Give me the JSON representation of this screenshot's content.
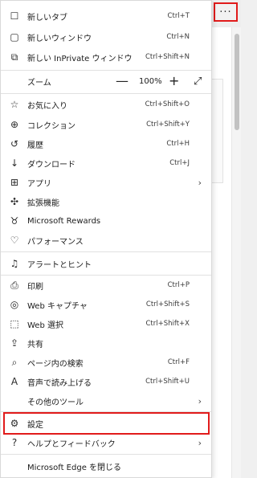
{
  "more_button": {
    "label": "···"
  },
  "menu": {
    "group1": [
      {
        "name": "new-tab",
        "icon": "new-tab-icon",
        "glyph": "☐",
        "label": "新しいタブ",
        "shortcut": "Ctrl+T"
      },
      {
        "name": "new-window",
        "icon": "new-window-icon",
        "glyph": "▢",
        "label": "新しいウィンドウ",
        "shortcut": "Ctrl+N"
      },
      {
        "name": "new-inprivate",
        "icon": "inprivate-icon",
        "glyph": "⧉",
        "label": "新しい InPrivate ウィンドウ",
        "shortcut": "Ctrl+Shift+N"
      }
    ],
    "zoom": {
      "label": "ズーム",
      "minus": "—",
      "value": "100%",
      "plus": "+",
      "expand": "⤢"
    },
    "group2": [
      {
        "name": "favorites",
        "icon": "favorites-icon",
        "glyph": "☆",
        "label": "お気に入り",
        "shortcut": "Ctrl+Shift+O"
      },
      {
        "name": "collections",
        "icon": "collections-icon",
        "glyph": "⊕",
        "label": "コレクション",
        "shortcut": "Ctrl+Shift+Y"
      },
      {
        "name": "history",
        "icon": "history-icon",
        "glyph": "↺",
        "label": "履歴",
        "shortcut": "Ctrl+H"
      },
      {
        "name": "downloads",
        "icon": "download-icon",
        "glyph": "↓",
        "label": "ダウンロード",
        "shortcut": "Ctrl+J"
      },
      {
        "name": "apps",
        "icon": "apps-icon",
        "glyph": "⊞",
        "label": "アプリ",
        "shortcut": "",
        "chevron": "›"
      },
      {
        "name": "extensions",
        "icon": "extensions-icon",
        "glyph": "✣",
        "label": "拡張機能",
        "shortcut": ""
      },
      {
        "name": "microsoft-rewards",
        "icon": "rewards-icon",
        "glyph": "♉",
        "label": "Microsoft Rewards",
        "shortcut": ""
      },
      {
        "name": "performance",
        "icon": "performance-icon",
        "glyph": "♡",
        "label": "パフォーマンス",
        "shortcut": ""
      }
    ],
    "group3": [
      {
        "name": "alerts-tips",
        "icon": "bell-icon",
        "glyph": "♫",
        "label": "アラートとヒント",
        "shortcut": ""
      }
    ],
    "group4": [
      {
        "name": "print",
        "icon": "printer-icon",
        "glyph": "⎙",
        "label": "印刷",
        "shortcut": "Ctrl+P"
      },
      {
        "name": "web-capture",
        "icon": "web-capture-icon",
        "glyph": "◎",
        "label": "Web キャプチャ",
        "shortcut": "Ctrl+Shift+S"
      },
      {
        "name": "web-select",
        "icon": "web-select-icon",
        "glyph": "⬚",
        "label": "Web 選択",
        "shortcut": "Ctrl+Shift+X"
      },
      {
        "name": "share",
        "icon": "share-icon",
        "glyph": "⇪",
        "label": "共有",
        "shortcut": ""
      },
      {
        "name": "find-on-page",
        "icon": "find-icon",
        "glyph": "⌕",
        "label": "ページ内の検索",
        "shortcut": "Ctrl+F"
      },
      {
        "name": "read-aloud",
        "icon": "read-aloud-icon",
        "glyph": "A",
        "label": "音声で読み上げる",
        "shortcut": "Ctrl+Shift+U"
      },
      {
        "name": "more-tools",
        "icon": "more-tools-icon",
        "glyph": "",
        "label": "その他のツール",
        "shortcut": "",
        "chevron": "›"
      }
    ],
    "group5": [
      {
        "name": "settings",
        "icon": "gear-icon",
        "glyph": "⚙",
        "label": "設定",
        "shortcut": ""
      },
      {
        "name": "help-feedback",
        "icon": "help-icon",
        "glyph": "?",
        "label": "ヘルプとフィードバック",
        "shortcut": "",
        "chevron": "›"
      }
    ],
    "group6": [
      {
        "name": "close-edge",
        "icon": "",
        "glyph": "",
        "label": "Microsoft Edge を閉じる",
        "shortcut": ""
      }
    ]
  },
  "colors": {
    "highlight": "#e11b1b"
  }
}
